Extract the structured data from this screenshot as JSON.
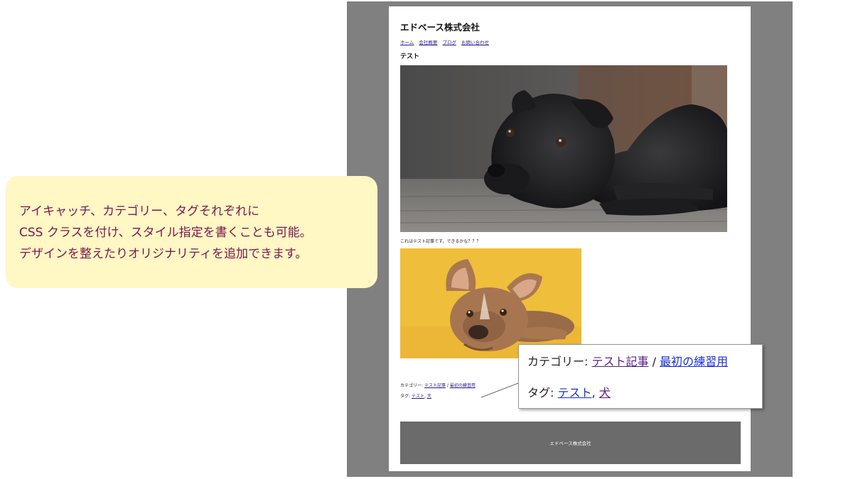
{
  "site": {
    "title": "エドベース株式会社",
    "nav": [
      "ホーム",
      "会社概要",
      "ブログ",
      "お問い合わせ"
    ]
  },
  "post": {
    "title": "テスト",
    "body": "これはテスト記事です。できるかな？？？",
    "category_label": "カテゴリー:",
    "categories": [
      "テスト記事",
      "最初の練習用"
    ],
    "separator": " / ",
    "tag_label": "タグ:",
    "tags": [
      "テスト",
      "犬"
    ],
    "tag_separator": ", "
  },
  "footer": {
    "text": "エドベース株式会社"
  },
  "callout": {
    "lines": [
      "アイキャッチ、カテゴリー、タグそれぞれに",
      "CSS クラスを付け、スタイル指定を書くことも可能。",
      "デザインを整えたりオリジナリティを追加できます。"
    ]
  },
  "colors": {
    "callout_text": "#7a1750",
    "callout_bg": "#fff7c4",
    "link_visited": "#5a1f8a",
    "link_unvisited": "#1a2fd6",
    "footer_bg": "#6b6b6b",
    "frame_bg": "#808080"
  }
}
